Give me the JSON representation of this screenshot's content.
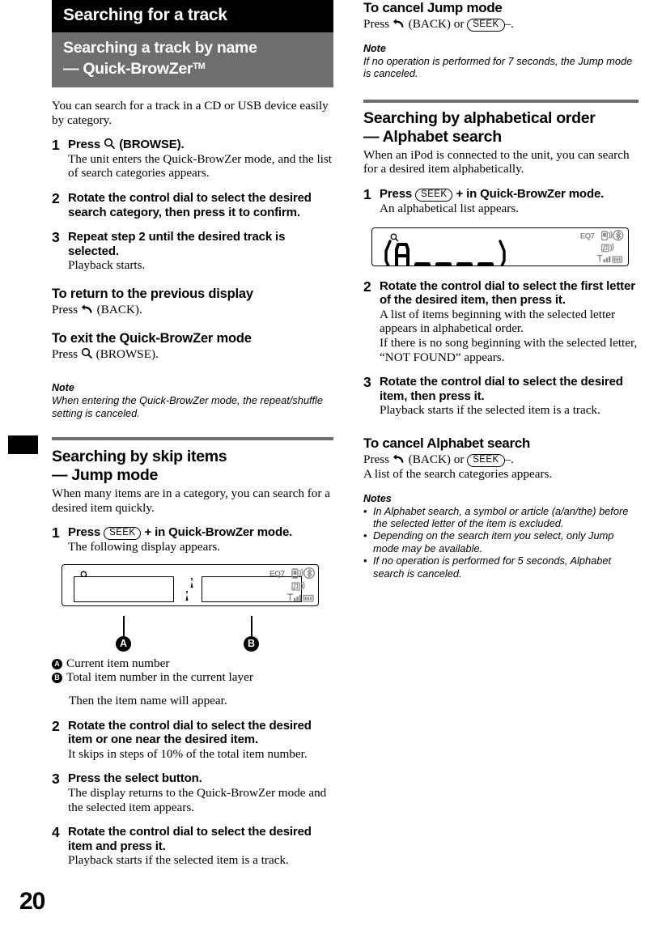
{
  "page": {
    "number": "20"
  },
  "chapter": {
    "title": "Searching for a track"
  },
  "section": {
    "title_line1": "Searching a track by name",
    "title_line2": "— Quick-BrowZer",
    "trademark": "TM"
  },
  "left_column": {
    "intro": "You can search for a track in a CD or USB device easily by category.",
    "steps": [
      {
        "num": "1",
        "title_pre": "Press",
        "title_icon": "browse-icon",
        "title_post": "(BROWSE).",
        "desc": "The unit enters the Quick-BrowZer mode, and the list of search categories appears."
      },
      {
        "num": "2",
        "title": "Rotate the control dial to select the desired search category, then press it to confirm.",
        "desc": ""
      },
      {
        "num": "3",
        "title": "Repeat step 2 until the desired track is selected.",
        "desc": "Playback starts."
      }
    ],
    "subhead_return": "To return to the previous display",
    "return_pre": "Press",
    "return_icon": "back-icon",
    "return_post": "(BACK).",
    "subhead_exit": "To exit the Quick-BrowZer mode",
    "exit_pre": "Press",
    "exit_icon": "browse-icon",
    "exit_post": "(BROWSE).",
    "note_label": "Note",
    "note_text": "When entering the Quick-BrowZer mode, the repeat/shuffle setting is canceled.",
    "jump_head_line1": "Searching by skip items",
    "jump_head_line2": "— Jump mode",
    "jump_intro": "When many items are in a category, you can search for a desired item quickly.",
    "jump_steps": [
      {
        "num": "1",
        "title_pre": "Press",
        "title_btn": "SEEK",
        "title_post": "+ in Quick-BrowZer mode.",
        "desc": "The following display appears."
      },
      {
        "num": "2",
        "title": "Rotate the control dial to select the desired item or one near the desired item.",
        "desc": "It skips in steps of 10% of the total item number."
      },
      {
        "num": "3",
        "title": "Press the select button.",
        "desc": "The display returns to the Quick-BrowZer mode and the selected item appears."
      },
      {
        "num": "4",
        "title": "Rotate the control dial to select the desired item and press it.",
        "desc": "Playback starts if the selected item is a track."
      }
    ],
    "callouts": [
      {
        "marker": "A",
        "text": "Current item number"
      },
      {
        "marker": "B",
        "text": "Total item number in the current layer"
      }
    ],
    "after_callouts": "Then the item name will appear."
  },
  "right_column": {
    "cancel_jump_head": "To cancel Jump mode",
    "cancel_jump_pre": "Press",
    "cancel_jump_icon": "back-icon",
    "cancel_jump_mid": "(BACK) or",
    "cancel_jump_btn": "SEEK",
    "cancel_jump_post": "–.",
    "note_label": "Note",
    "note_text": "If no operation is performed for 7 seconds, the Jump mode is canceled.",
    "alpha_head_line1": "Searching by alphabetical order",
    "alpha_head_line2": "— Alphabet search",
    "alpha_intro": "When an iPod is connected to the unit, you can search for a desired item alphabetically.",
    "alpha_steps": [
      {
        "num": "1",
        "title_pre": "Press",
        "title_btn": "SEEK",
        "title_post": "+ in Quick-BrowZer mode.",
        "desc": "An alphabetical list appears."
      },
      {
        "num": "2",
        "title": "Rotate the control dial to select the first letter of the desired item, then press it.",
        "desc": "A list of items beginning with the selected letter appears in alphabetical order.\nIf there is no song beginning with the selected letter, “NOT FOUND” appears."
      },
      {
        "num": "3",
        "title": "Rotate the control dial to select the desired item, then press it.",
        "desc": "Playback starts if the selected item is a track."
      }
    ],
    "cancel_alpha_head": "To cancel Alphabet search",
    "cancel_alpha_pre": "Press",
    "cancel_alpha_icon": "back-icon",
    "cancel_alpha_mid": "(BACK) or",
    "cancel_alpha_btn": "SEEK",
    "cancel_alpha_post": "–.",
    "cancel_alpha_desc": "A list of the search categories appears.",
    "notes_label": "Notes",
    "notes": [
      "In Alphabet search, a symbol or article (a/an/the) before the selected letter of the item is excluded.",
      "Depending on the search item you select, only Jump mode may be available.",
      "If no operation is performed for 5 seconds, Alphabet search is canceled."
    ]
  },
  "lcd_display": {
    "magnifier": "browse-icon",
    "separator": "/",
    "status_icons": [
      "eq7-indicator",
      "phone-signal-icon",
      "bluetooth-icon",
      "music-signal-icon",
      "antenna-bars-icon",
      "battery-icon"
    ],
    "eq_label": "EQ7"
  },
  "lcd_display_alpha": {
    "magnifier": "browse-icon",
    "text": "(A____)",
    "status_icons": [
      "eq7-indicator",
      "phone-signal-icon",
      "bluetooth-icon",
      "music-signal-icon",
      "antenna-bars-icon",
      "battery-icon"
    ],
    "eq_label": "EQ7"
  },
  "colors": {
    "chapter_bar": "#000000",
    "section_bar": "#6e6e6e",
    "rule": "#6e6e6e",
    "lcd_icon_grey": "#8a8a8a"
  }
}
